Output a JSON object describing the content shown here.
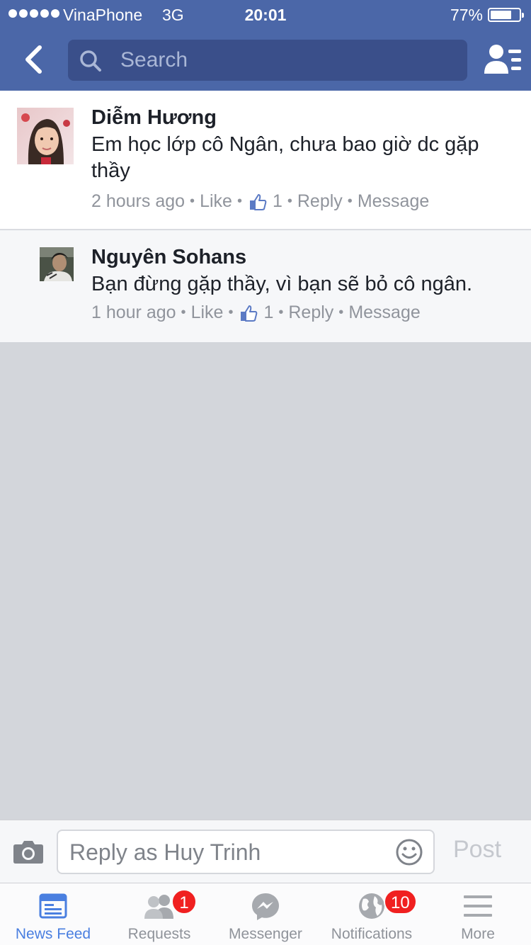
{
  "status_bar": {
    "carrier": "VinaPhone",
    "network": "3G",
    "time": "20:01",
    "battery_percent": "77%",
    "battery_level": 0.77
  },
  "nav": {
    "search_placeholder": "Search"
  },
  "comments": [
    {
      "author": "Diễm Hương",
      "text": "Em học lớp cô Ngân, chưa bao giờ dc gặp thầy",
      "time": "2 hours ago",
      "like_label": "Like",
      "like_count": "1",
      "reply_label": "Reply",
      "message_label": "Message"
    },
    {
      "author": "Nguyên Sohans",
      "text": "Bạn đừng gặp thầy, vì bạn sẽ bỏ cô ngân.",
      "time": "1 hour ago",
      "like_label": "Like",
      "like_count": "1",
      "reply_label": "Reply",
      "message_label": "Message"
    }
  ],
  "composer": {
    "placeholder": "Reply as Huy Trinh",
    "post_label": "Post"
  },
  "tabs": [
    {
      "label": "News Feed",
      "icon": "news-feed-icon",
      "active": true
    },
    {
      "label": "Requests",
      "icon": "friend-requests-icon",
      "badge": "1"
    },
    {
      "label": "Messenger",
      "icon": "messenger-icon"
    },
    {
      "label": "Notifications",
      "icon": "globe-icon",
      "badge": "10"
    },
    {
      "label": "More",
      "icon": "menu-icon"
    }
  ],
  "colors": {
    "brand": "#4b67a8",
    "active_tab": "#4a7fe0",
    "badge": "#f02020"
  }
}
